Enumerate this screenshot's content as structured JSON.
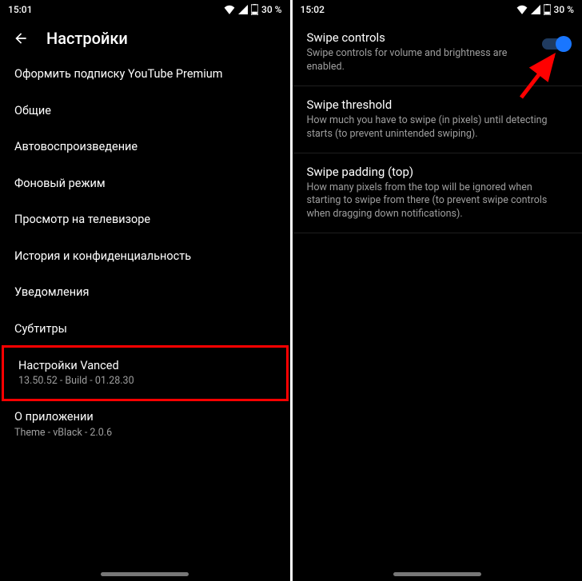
{
  "left": {
    "status": {
      "time": "15:01",
      "battery": "30 %"
    },
    "header_title": "Настройки",
    "items": [
      {
        "title": "Оформить подписку YouTube Premium",
        "sub": null
      },
      {
        "title": "Общие",
        "sub": null
      },
      {
        "title": "Автовоспроизведение",
        "sub": null
      },
      {
        "title": "Фоновый режим",
        "sub": null
      },
      {
        "title": "Просмотр на телевизоре",
        "sub": null
      },
      {
        "title": "История и конфиденциальность",
        "sub": null
      },
      {
        "title": "Уведомления",
        "sub": null
      },
      {
        "title": "Субтитры",
        "sub": null
      },
      {
        "title": "Настройки Vanced",
        "sub": "13.50.52 - Build - 01.28.30"
      },
      {
        "title": "О приложении",
        "sub": "Theme - vBlack - 2.0.6"
      }
    ],
    "highlight_index": 8
  },
  "right": {
    "status": {
      "time": "15:02",
      "battery": "30 %"
    },
    "settings": [
      {
        "title": "Swipe controls",
        "desc": "Swipe controls for volume and brightness are enabled.",
        "toggle": true
      },
      {
        "title": "Swipe threshold",
        "desc": "How much you have to swipe (in pixels) until detecting starts (to prevent unintended swiping)."
      },
      {
        "title": "Swipe padding (top)",
        "desc": "How many pixels from the top will be ignored when starting to swipe from there (to prevent swipe controls when dragging down notifications)."
      }
    ]
  }
}
